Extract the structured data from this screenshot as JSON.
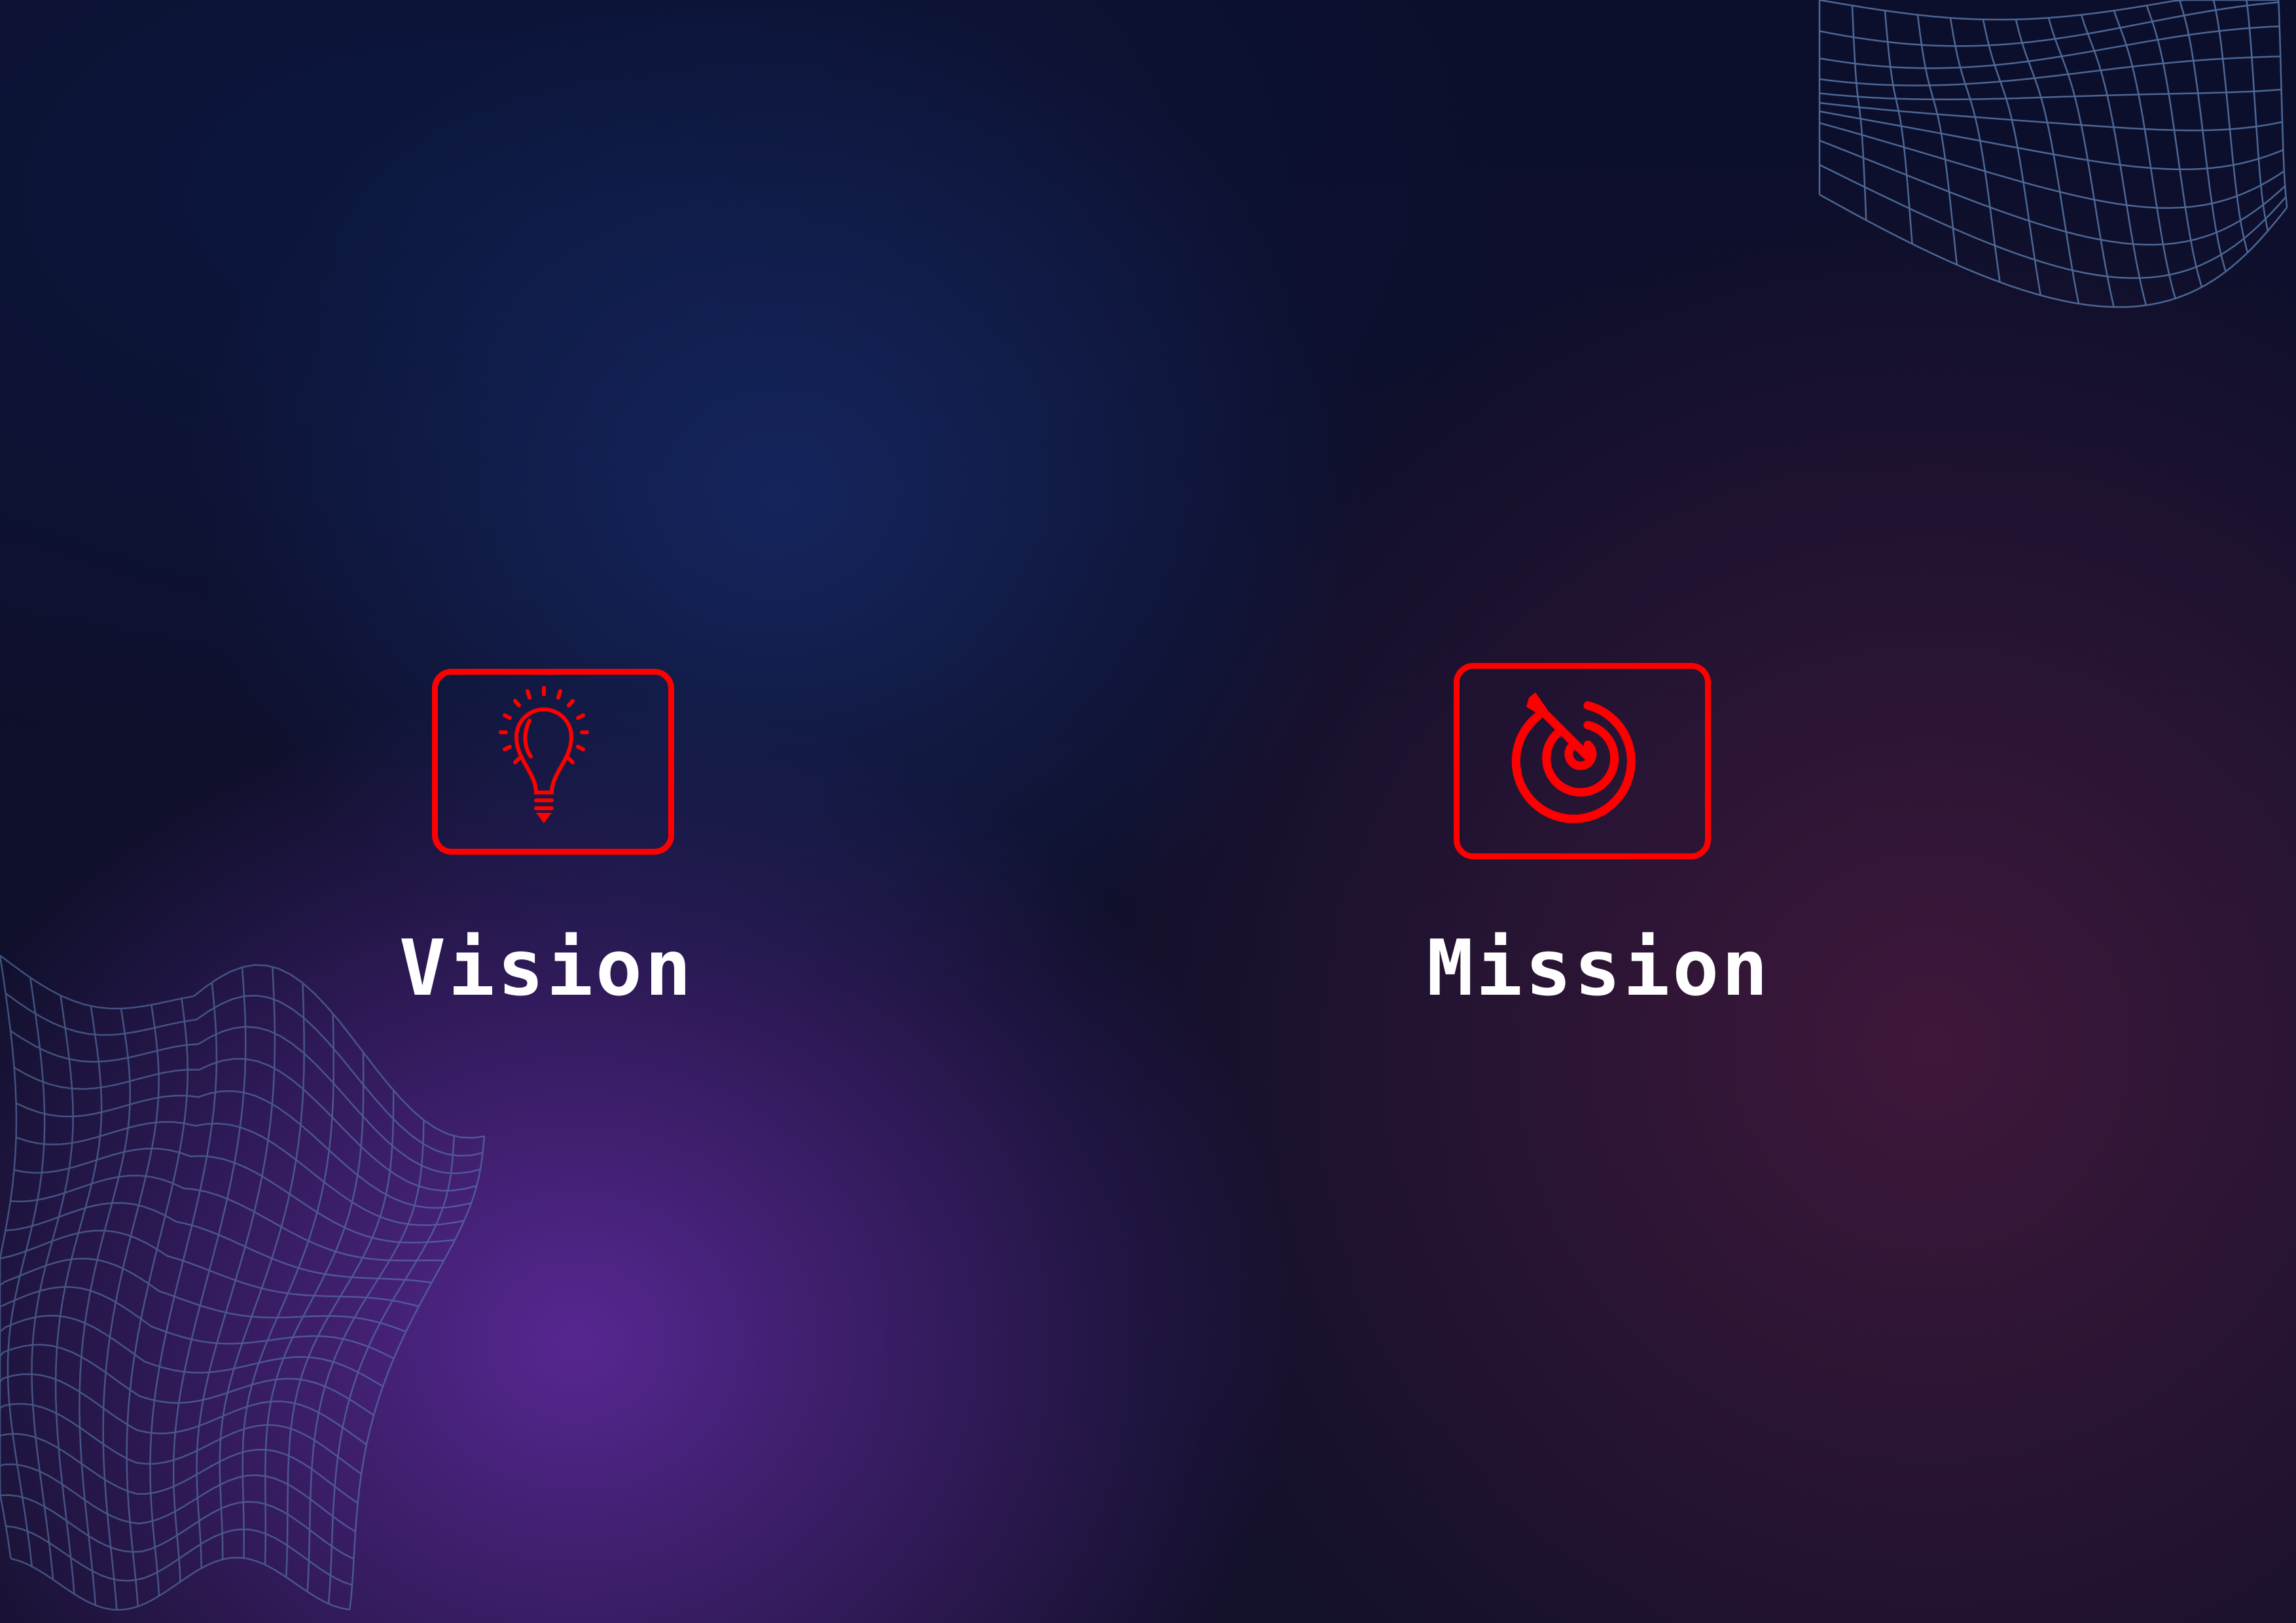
{
  "colors": {
    "accent": "#ff0000",
    "text": "#ffffff",
    "mesh": "#5b7db0"
  },
  "items": [
    {
      "label": "Vision",
      "icon": "lightbulb-icon"
    },
    {
      "label": "Mission",
      "icon": "target-arrow-icon"
    }
  ]
}
